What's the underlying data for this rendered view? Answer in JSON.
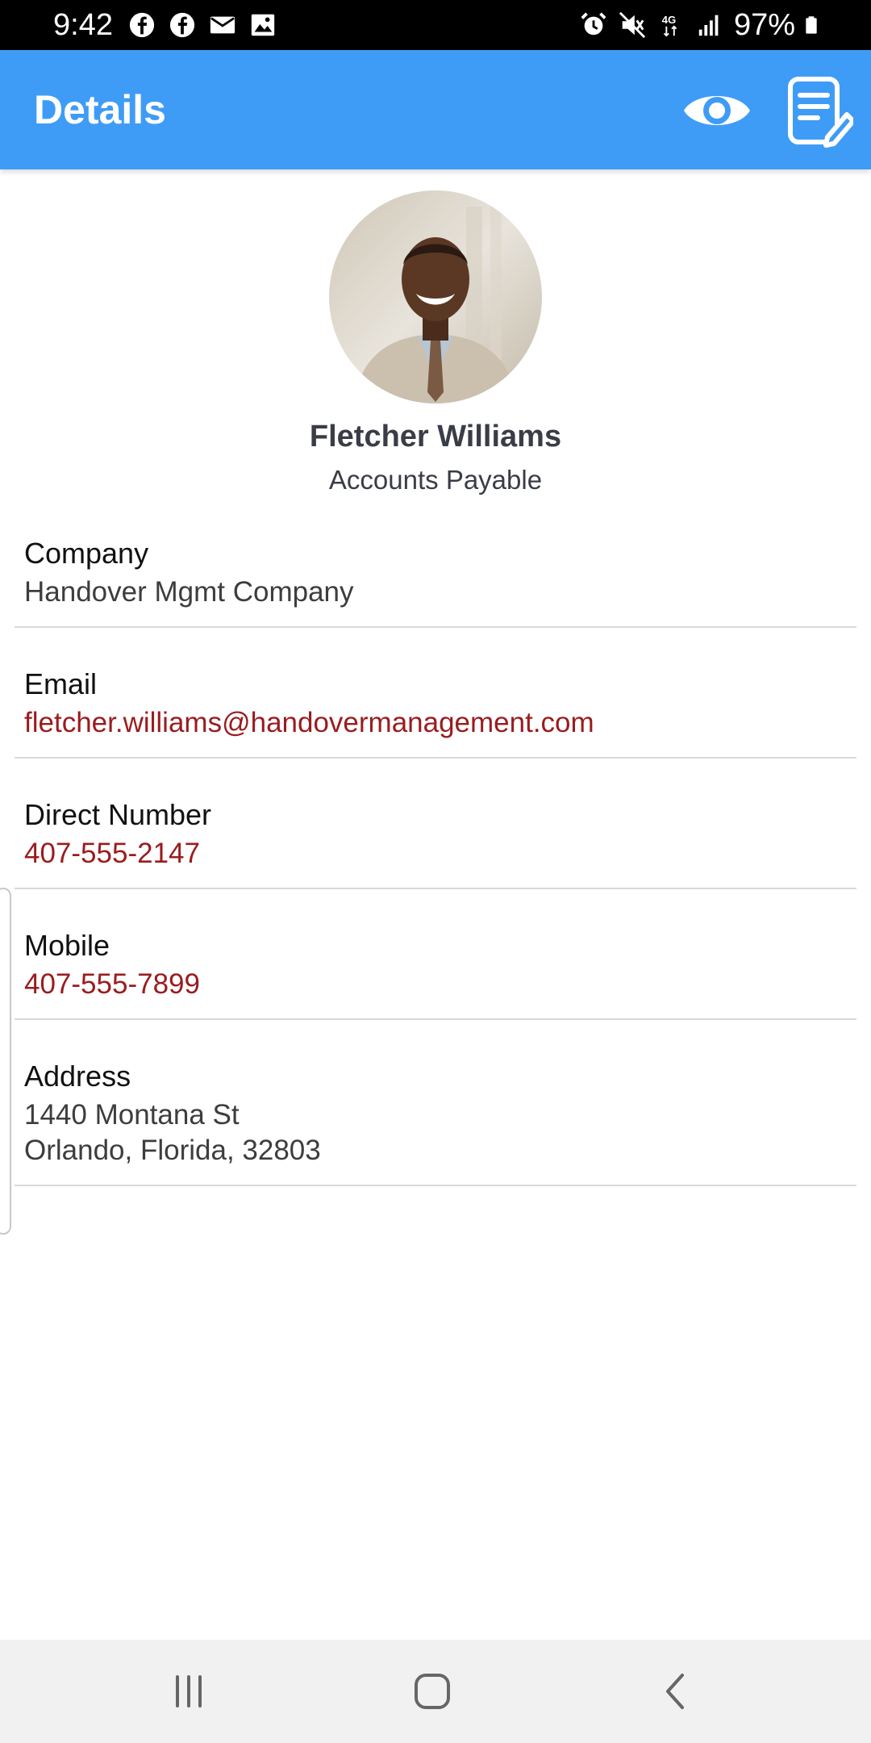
{
  "status_bar": {
    "time": "9:42",
    "battery": "97%",
    "icons": [
      "facebook-icon",
      "facebook-icon",
      "mail-icon",
      "image-icon",
      "alarm-icon",
      "mute-icon",
      "network-4g-icon",
      "signal-icon",
      "battery-icon"
    ]
  },
  "app_bar": {
    "title": "Details",
    "actions": [
      "eye-icon",
      "edit-note-icon"
    ],
    "color": "#3f9cf6"
  },
  "profile": {
    "name": "Fletcher Williams",
    "title": "Accounts Payable"
  },
  "details": [
    {
      "label": "Company",
      "value": "Handover Mgmt Company"
    },
    {
      "label": "Email",
      "value": "fletcher.williams@handovermanagement.com"
    },
    {
      "label": "Direct Number",
      "value": "407-555-2147"
    },
    {
      "label": "Mobile",
      "value": "407-555-7899"
    },
    {
      "label": "Address",
      "value_line1": "1440 Montana St",
      "value_line2": "Orlando, Florida, 32803"
    }
  ],
  "link_color": "#9a1c1f",
  "nav_bar": {
    "buttons": [
      "recents-icon",
      "home-icon",
      "back-icon"
    ]
  }
}
